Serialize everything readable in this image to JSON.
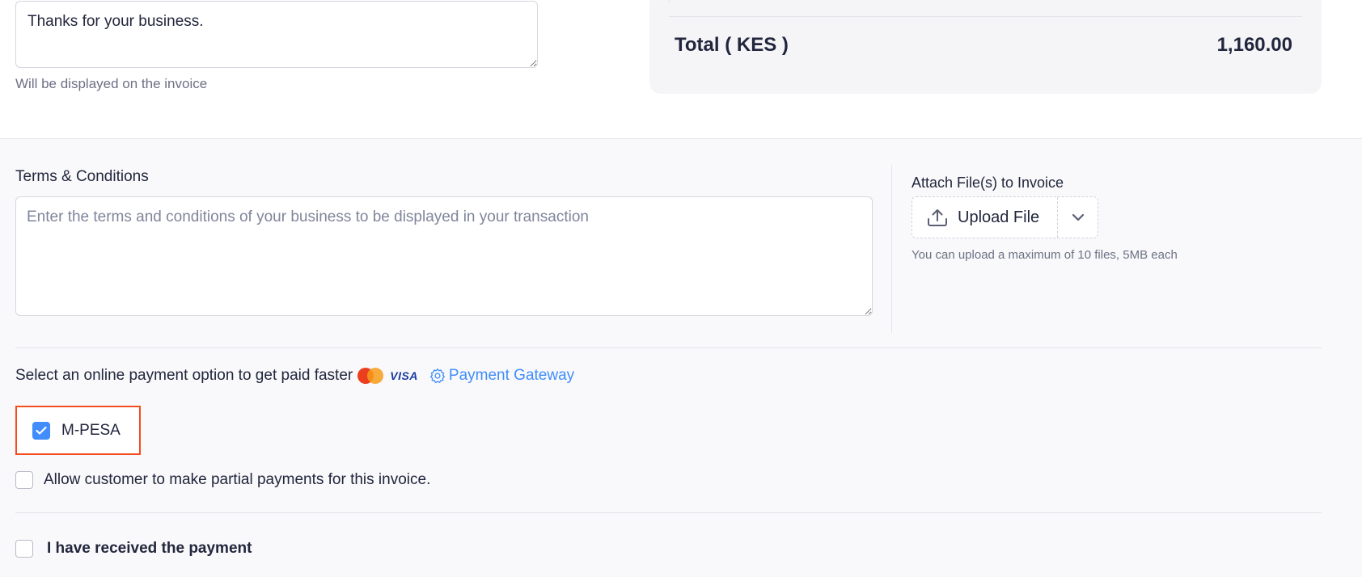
{
  "customer_notes": {
    "value": "Thanks for your business.",
    "hint": "Will be displayed on the invoice"
  },
  "total": {
    "label": "Total ( KES )",
    "value": "1,160.00"
  },
  "terms": {
    "label": "Terms & Conditions",
    "placeholder": "Enter the terms and conditions of your business to be displayed in your transaction"
  },
  "attachments": {
    "label": "Attach File(s) to Invoice",
    "upload_label": "Upload File",
    "hint": "You can upload a maximum of 10 files, 5MB each"
  },
  "payment": {
    "prompt": "Select an online payment option to get paid faster",
    "visa_text": "VISA",
    "gateway_link": "Payment Gateway",
    "mpesa": {
      "label": "M-PESA",
      "checked": true
    },
    "partial": {
      "label": "Allow customer to make partial payments for this invoice.",
      "checked": false
    },
    "received": {
      "label": "I have received the payment",
      "checked": false
    }
  },
  "colors": {
    "accent": "#408dfb",
    "highlight": "#f24e1e"
  }
}
